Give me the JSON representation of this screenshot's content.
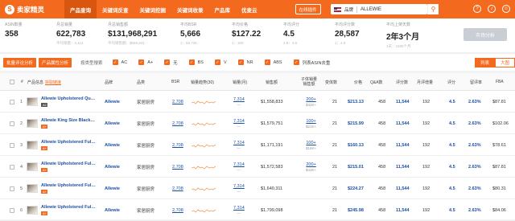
{
  "app": {
    "logo_mark": "S",
    "logo_text": "卖家精灵"
  },
  "nav": [
    "产品查询",
    "关键词反查",
    "关键词挖掘",
    "关键词收录",
    "产品库",
    "优麦云"
  ],
  "tool_button": "在线插件",
  "search": {
    "type": "品牌",
    "value": "ALLEWIE",
    "button_icon": "search-icon"
  },
  "top_icons": [
    "help-icon",
    "bell-icon",
    "user-icon"
  ],
  "stats": [
    {
      "label": "ASIN数量",
      "value": "358",
      "sub": ""
    },
    {
      "label": "月总销量",
      "value": "622,783",
      "sub": "平均销量：3,114"
    },
    {
      "label": "月总销售额",
      "value": "$131,968,291",
      "sub": "平均销售额：$659,841"
    },
    {
      "label": "平均BSR",
      "value": "5,666",
      "sub": "1：58,735"
    },
    {
      "label": "平均价格",
      "value": "$127.22",
      "sub": "1：100"
    },
    {
      "label": "平均评分",
      "value": "4.5",
      "sub": "2.8：4.9"
    },
    {
      "label": "平均评分数",
      "value": "28,587",
      "sub": "1：4.9"
    },
    {
      "label": "平均上架天数",
      "value": "2年3个月",
      "sub": "1天：1595个月"
    }
  ],
  "market_button": "市场分析",
  "filters": {
    "buttons": [
      "批量评论分析",
      "产品属性分析"
    ],
    "label": "按类型搜索",
    "checks": [
      "AC",
      "A+",
      "无",
      "BS",
      "V",
      "NR",
      "ABS",
      "列表ASIN去重"
    ],
    "view_list": "列表",
    "view_large": "大图"
  },
  "columns": {
    "num": "#",
    "product": "产品信息",
    "product_link": "获取链接",
    "brand": "品牌",
    "category": "品类",
    "bsr": "BSR",
    "trend": "销量趋势(30)",
    "sales": "销量(月)",
    "revenue": "销售额",
    "variants": "子体销量\n销售额",
    "variant_count": "变体数",
    "price": "价格",
    "qa": "Q&A数",
    "reviews": "评分数",
    "monthly_reviews": "月评增量",
    "rating": "评分",
    "rating_rate": "留评率",
    "fba": "FBA"
  },
  "rows": [
    {
      "num": "1",
      "title": "Allewie Upholstered Que...",
      "tag": "AC",
      "tag_dark": true,
      "brand": "Allewie",
      "category": "家居厨房",
      "bsr": "2,708",
      "sales": "7,314",
      "revenue": "$1,558,833",
      "child_sales": "200+",
      "child_rev": "$42K+",
      "variants": "21",
      "price": "$213.13",
      "qa": "458",
      "reviews": "11,544",
      "monthly": "192",
      "rating": "4.5",
      "rate": "2.63%",
      "fba": "$87.81"
    },
    {
      "num": "2",
      "title": "Allewie King Size Black M...",
      "tag": "A+",
      "tag_dark": false,
      "brand": "Allewie",
      "category": "家居厨房",
      "bsr": "2,708",
      "sales": "7,314",
      "revenue": "$1,579,751",
      "child_sales": "100+",
      "child_rev": "$21K+",
      "variants": "21",
      "price": "$215.99",
      "qa": "458",
      "reviews": "11,544",
      "monthly": "192",
      "rating": "4.5",
      "rate": "2.63%",
      "fba": "$102.06"
    },
    {
      "num": "3",
      "title": "Allewie Upholstered Full ...",
      "tag": "A+",
      "tag_dark": false,
      "brand": "Allewie",
      "category": "家居厨房",
      "bsr": "2,708",
      "sales": "7,314",
      "revenue": "$1,171,191",
      "child_sales": "100+",
      "child_rev": "$16K+",
      "variants": "21",
      "price": "$160.13",
      "qa": "458",
      "reviews": "11,544",
      "monthly": "192",
      "rating": "4.5",
      "rate": "2.63%",
      "fba": "$78.61"
    },
    {
      "num": "4",
      "title": "Allewie Upholstered Full ...",
      "tag": "A+",
      "tag_dark": false,
      "brand": "Allewie",
      "category": "家居厨房",
      "bsr": "2,708",
      "sales": "7,314",
      "revenue": "$1,572,583",
      "child_sales": "200+",
      "child_rev": "$43K+",
      "variants": "21",
      "price": "$215.01",
      "qa": "458",
      "reviews": "11,544",
      "monthly": "192",
      "rating": "4.5",
      "rate": "2.63%",
      "fba": "$87.81"
    },
    {
      "num": "5",
      "title": "Allewie Upholstered Full ...",
      "tag": "A+",
      "tag_dark": false,
      "brand": "Allewie",
      "category": "家居厨房",
      "bsr": "2,708",
      "sales": "7,314",
      "revenue": "$1,640,311",
      "child_sales": "",
      "child_rev": "",
      "variants": "21",
      "price": "$224.27",
      "qa": "458",
      "reviews": "11,544",
      "monthly": "192",
      "rating": "4.5",
      "rate": "2.63%",
      "fba": "$80.31"
    },
    {
      "num": "6",
      "title": "Allewie Upholstered Full ...",
      "tag": "A+",
      "tag_dark": false,
      "brand": "Allewie",
      "category": "家居厨房",
      "bsr": "2,708",
      "sales": "7,314",
      "revenue": "$1,799,098",
      "child_sales": "",
      "child_rev": "",
      "variants": "21",
      "price": "$245.98",
      "qa": "458",
      "reviews": "11,544",
      "monthly": "192",
      "rating": "4.5",
      "rate": "2.63%",
      "fba": "$84.06"
    }
  ],
  "colors": {
    "brand": "#f36a1e",
    "link": "#1a4fa3",
    "spark": "#f0a060"
  }
}
